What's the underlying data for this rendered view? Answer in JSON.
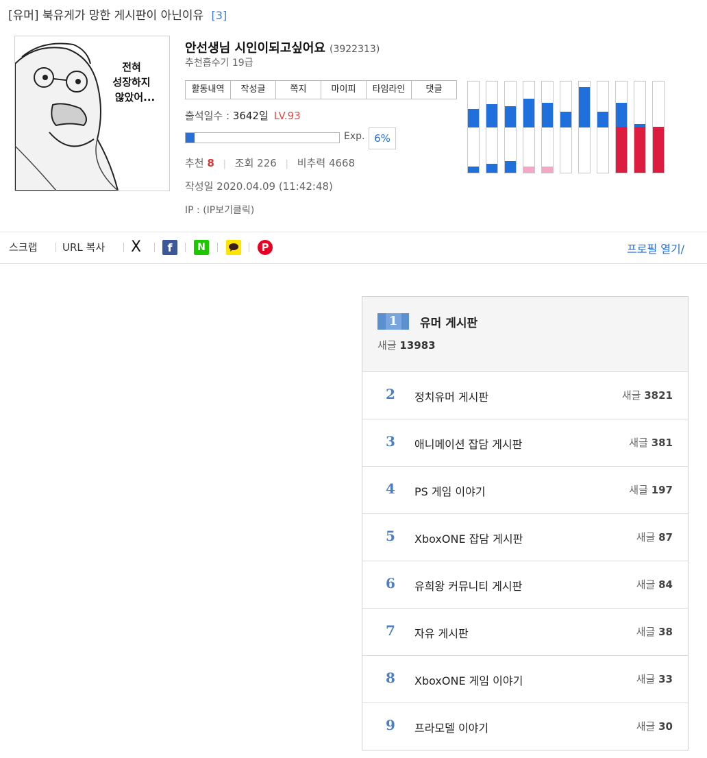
{
  "post": {
    "category": "[유머]",
    "title": "북유게가 망한 게시판이 아닌이유",
    "comment_count": "[3]"
  },
  "author": {
    "avatar_caption_lines": [
      "전혀",
      "성장하지",
      "않았어..."
    ],
    "nickname": "안선생님 시인이되고싶어요",
    "uid": "(3922313)",
    "rank": "추천흡수기 19급",
    "menu": [
      {
        "label": "활동내역"
      },
      {
        "label": "작성글"
      },
      {
        "label": "쪽지"
      },
      {
        "label": "마이피"
      },
      {
        "label": "타임라인"
      },
      {
        "label": "댓글"
      }
    ],
    "attendance_label": "출석일수 : ",
    "attendance_days": "3642일",
    "level": "LV.93",
    "exp_label": "Exp.",
    "exp_percent": "6%",
    "exp_value": 0.06,
    "stats": {
      "recommend_label": "추천",
      "recommend_value": "8",
      "views_label": "조회",
      "views_value": "226",
      "ratio_label": "비추력",
      "ratio_value": "4668"
    },
    "date": "작성일 2020.04.09 (11:42:48)",
    "ip": "IP : (IP보기클릭)",
    "activity": {
      "colors": {
        "blue": "#1f6fdc",
        "pink": "#f5a8c6",
        "red": "#dd1c3f"
      },
      "columns": [
        {
          "top": 0.4,
          "bottom_blue": 0.14
        },
        {
          "top": 0.5,
          "bottom_blue": 0.19
        },
        {
          "top": 0.46,
          "bottom_blue": 0.25
        },
        {
          "top": 0.62,
          "bottom_pink": 0.13
        },
        {
          "top": 0.54,
          "bottom_pink": 0.13
        },
        {
          "top": 0.34
        },
        {
          "top": 0.88
        },
        {
          "top": 0.34
        },
        {
          "top": 0.54,
          "bottom_red": 1.0
        },
        {
          "top": 0.08,
          "bottom_red": 1.0
        },
        {
          "bottom_red": 1.0
        }
      ]
    }
  },
  "share": {
    "scrap": "스크랩",
    "url_copy": "URL 복사",
    "x_glyph": "X",
    "fb_glyph": "f",
    "naver_glyph": "N",
    "pin_glyph": "P",
    "profile_open": "프로필 열기/"
  },
  "boards": {
    "top": {
      "rank": "1",
      "name": "유머 게시판",
      "count_label": "새글",
      "count": "13983"
    },
    "rows": [
      {
        "rank": "2",
        "name": "정치유머 게시판",
        "count_label": "새글",
        "count": "3821"
      },
      {
        "rank": "3",
        "name": "애니메이션 잡담 게시판",
        "count_label": "새글",
        "count": "381"
      },
      {
        "rank": "4",
        "name": "PS 게임 이야기",
        "count_label": "새글",
        "count": "197"
      },
      {
        "rank": "5",
        "name": "XboxONE 잡담 게시판",
        "count_label": "새글",
        "count": "87"
      },
      {
        "rank": "6",
        "name": "유희왕 커뮤니티 게시판",
        "count_label": "새글",
        "count": "84"
      },
      {
        "rank": "7",
        "name": "자유 게시판",
        "count_label": "새글",
        "count": "38"
      },
      {
        "rank": "8",
        "name": "XboxONE 게임 이야기",
        "count_label": "새글",
        "count": "33"
      },
      {
        "rank": "9",
        "name": "프라모델 이야기",
        "count_label": "새글",
        "count": "30"
      }
    ]
  }
}
